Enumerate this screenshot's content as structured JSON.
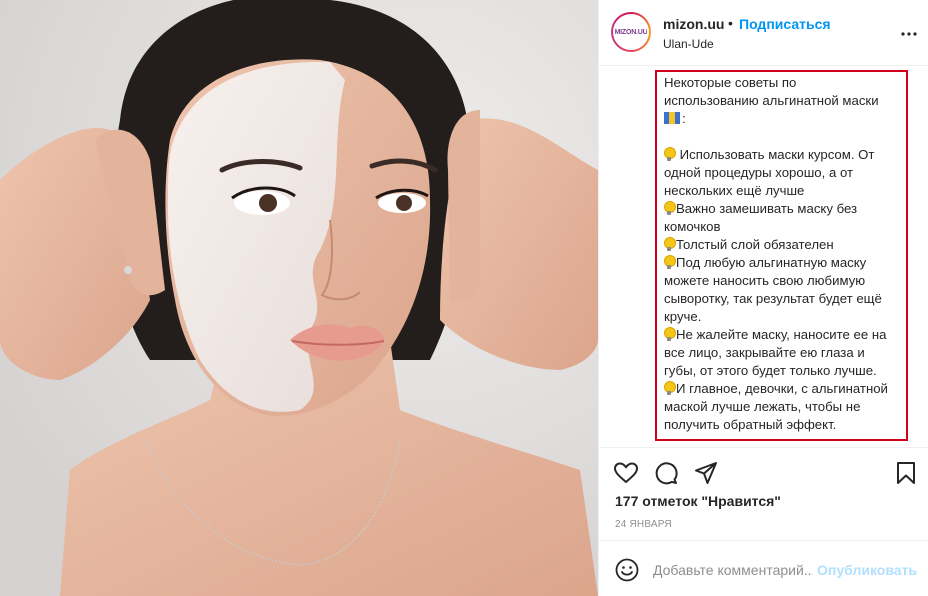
{
  "post": {
    "photo": {
      "alt_icon": "face-mask-photo"
    },
    "header": {
      "username": "mizon.uu",
      "separator": "•",
      "follow_label": "Подписаться",
      "location": "Ulan-Ude",
      "avatar_text": "MIZON.UU",
      "more_icon": "more-horizontal-icon"
    },
    "caption": {
      "intro_1": "Некоторые советы по",
      "intro_2": "использованию альгинатной маски",
      "intro_3": ":",
      "tips": [
        " Использовать маски курсом. От одной процедуры хорошо, а от нескольких ещё лучше",
        "Важно замешивать маску без комочков",
        "Толстый слой обязателен",
        "Под любую альгинатную маску можете наносить свою любимую сыворотку, так результат будет ещё круче.",
        "Не жалейте маску, наносите ее на все лицо, закрывайте ею глаза и губы, от этого будет только лучше.",
        "И главное, девочки, с альгинатной маской лучше лежать, чтобы не получить обратный эффект."
      ],
      "highlight_color": "#d0021b"
    },
    "actions": {
      "like_icon": "heart-icon",
      "comment_icon": "comment-icon",
      "share_icon": "share-icon",
      "save_icon": "bookmark-icon"
    },
    "likes_text": "177 отметок \"Нравится\"",
    "date_text": "24 ЯНВАРЯ",
    "comment": {
      "emoji_icon": "smiley-icon",
      "placeholder": "Добавьте комментарий...",
      "value": "",
      "publish_label": "Опубликовать"
    },
    "colors": {
      "accent_blue": "#0095f6",
      "publish_disabled": "#b2dffc",
      "text": "#262626",
      "muted": "#8e8e8e"
    }
  }
}
